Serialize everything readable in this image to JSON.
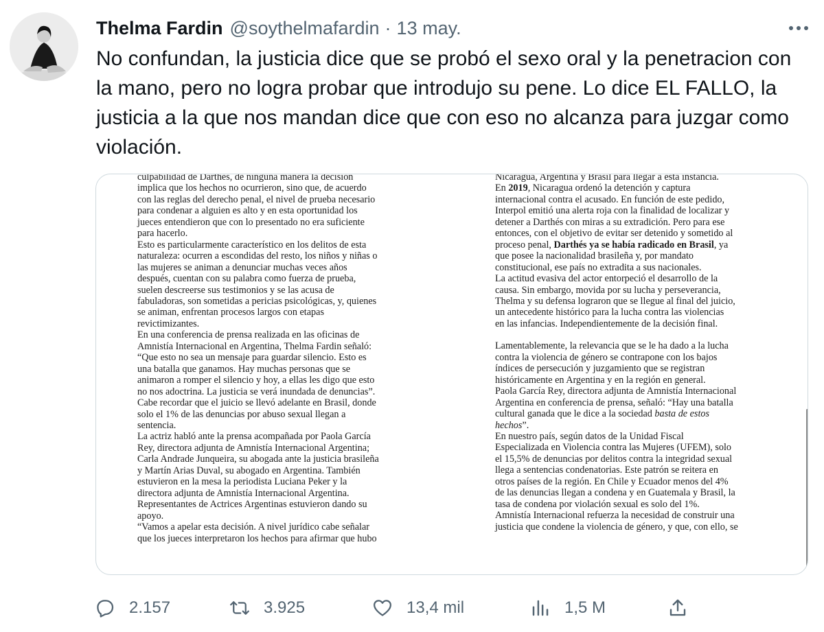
{
  "author": {
    "name": "Thelma Fardin",
    "handle": "@soythelmafardin",
    "separator": "·",
    "date": "13 may."
  },
  "tweet": {
    "text": "No confundan, la justicia dice que se probó el sexo oral y la penetracion con la mano, pero no logra probar que introdujo su pene. Lo dice EL FALLO, la justicia a la que nos mandan dice que con eso no alcanza para juzgar como violación."
  },
  "document": {
    "left_column": [
      "culpabilidad de Darthés, de ninguna manera la decisión",
      "implica que los hechos no ocurrieron, sino que, de acuerdo",
      "con las reglas del derecho penal, el nivel de prueba necesario",
      "para condenar a alguien es alto y en esta oportunidad los",
      "jueces entendieron que con lo presentado no era suficiente",
      "para hacerlo.",
      "Esto es particularmente característico en los delitos de esta",
      "naturaleza: ocurren a escondidas del resto, los niños y niñas o",
      "las mujeres se animan a denunciar muchas veces años",
      "después, cuentan con su palabra como fuerza de prueba,",
      "suelen descreerse sus testimonios y se las acusa de",
      "fabuladoras, son sometidas a pericias psicológicas, y, quienes",
      "se animan, enfrentan procesos largos con etapas",
      "revictimizantes.",
      "En una conferencia de prensa realizada en las oficinas de",
      "Amnistía Internacional en Argentina, Thelma Fardin señaló:",
      "“Que esto no sea un mensaje para guardar silencio. Esto es",
      "una batalla que ganamos. Hay muchas personas que se",
      "animaron a romper el silencio y hoy, a ellas les digo que esto",
      "no nos adoctrina. La justicia se verá inundada de denuncias”.",
      "Cabe recordar que el juicio se llevó adelante en Brasil, donde",
      "solo el 1% de las denuncias por abuso sexual llegan a",
      "sentencia.",
      "La actriz habló ante la prensa acompañada por Paola García",
      "Rey, directora adjunta de Amnistía Internacional Argentina;",
      "Carla Andrade Junqueira, su abogada ante la justicia brasileña",
      "y Martín Arias Duval, su abogado en Argentina. También",
      "estuvieron en la mesa la periodista Luciana Peker y la",
      "directora adjunta de Amnistía Internacional Argentina.",
      "Representantes de Actrices Argentinas estuvieron dando su",
      "apoyo.",
      "“Vamos a apelar esta decisión. A nivel jurídico cabe señalar",
      "que los jueces interpretaron los hechos para afirmar que hubo"
    ],
    "right_column": {
      "p1_line1": "Nicaragua, Argentina y Brasil para llegar a esta instancia.",
      "p2_pre": "En ",
      "p2_year": "2019",
      "p2_post": ", Nicaragua ordenó la detención y captura",
      "p2_lines": [
        "internacional contra el acusado. En función de este pedido,",
        "Interpol emitió una alerta roja con la finalidad de localizar y",
        "detener a Darthés con miras a su extradición. Pero para ese",
        "entonces, con el objetivo de evitar ser detenido y sometido al"
      ],
      "p2_bold_pre": "proceso penal, ",
      "p2_bold": "Darthés ya se había radicado en Brasil",
      "p2_bold_post": ", ya",
      "p2_tail": [
        "que posee la nacionalidad brasileña y, por mandato",
        "constitucional, ese país no extradita a sus nacionales."
      ],
      "p3_lines": [
        "La actitud evasiva del actor entorpeció el desarrollo de la",
        "causa. Sin embargo, movida por su lucha y perseverancia,",
        "Thelma y su defensa lograron que se llegue al final del juicio,",
        "un antecedente histórico para la lucha contra las violencias",
        "en las infancias. Independientemente de la decisión final."
      ],
      "p4_lines": [
        "Lamentablemente, la relevancia que se le ha dado a la lucha",
        "contra la violencia de género se contrapone con los bajos",
        "índices de persecución y juzgamiento que se registran",
        "históricamente en Argentina y en la región en general.",
        "Paola García Rey, directora adjunta de Amnistía Internacional",
        "Argentina en conferencia de prensa, señaló: “Hay una batalla"
      ],
      "p4_italic_pre": "cultural ganada que le dice a la sociedad ",
      "p4_italic_1": "basta de estos",
      "p4_italic_2": "hechos",
      "p4_italic_post": "”.",
      "p5_lines": [
        "En nuestro país, según datos de la Unidad Fiscal",
        "Especializada en Violencia contra las Mujeres (UFEM), solo",
        "el 15,5% de denuncias por delitos contra la integridad sexual",
        "llega a sentencias condenatorias. Este patrón se reitera en",
        "otros países de la región. En Chile y Ecuador menos del 4%",
        "de las denuncias llegan a condena y en Guatemala y Brasil, la",
        "tasa de condena por violación sexual es solo del 1%.",
        "Amnistía Internacional refuerza la necesidad de construir una",
        "justicia que condene la violencia de género, y que, con ello, se"
      ]
    }
  },
  "actions": {
    "replies": "2.157",
    "retweets": "3.925",
    "likes": "13,4 mil",
    "views": "1,5 M"
  },
  "icons": [
    "more-icon",
    "reply-icon",
    "retweet-icon",
    "like-icon",
    "views-icon",
    "share-icon"
  ],
  "colors": {
    "text": "#0f1419",
    "secondary": "#536471",
    "border": "#cfd9de"
  }
}
